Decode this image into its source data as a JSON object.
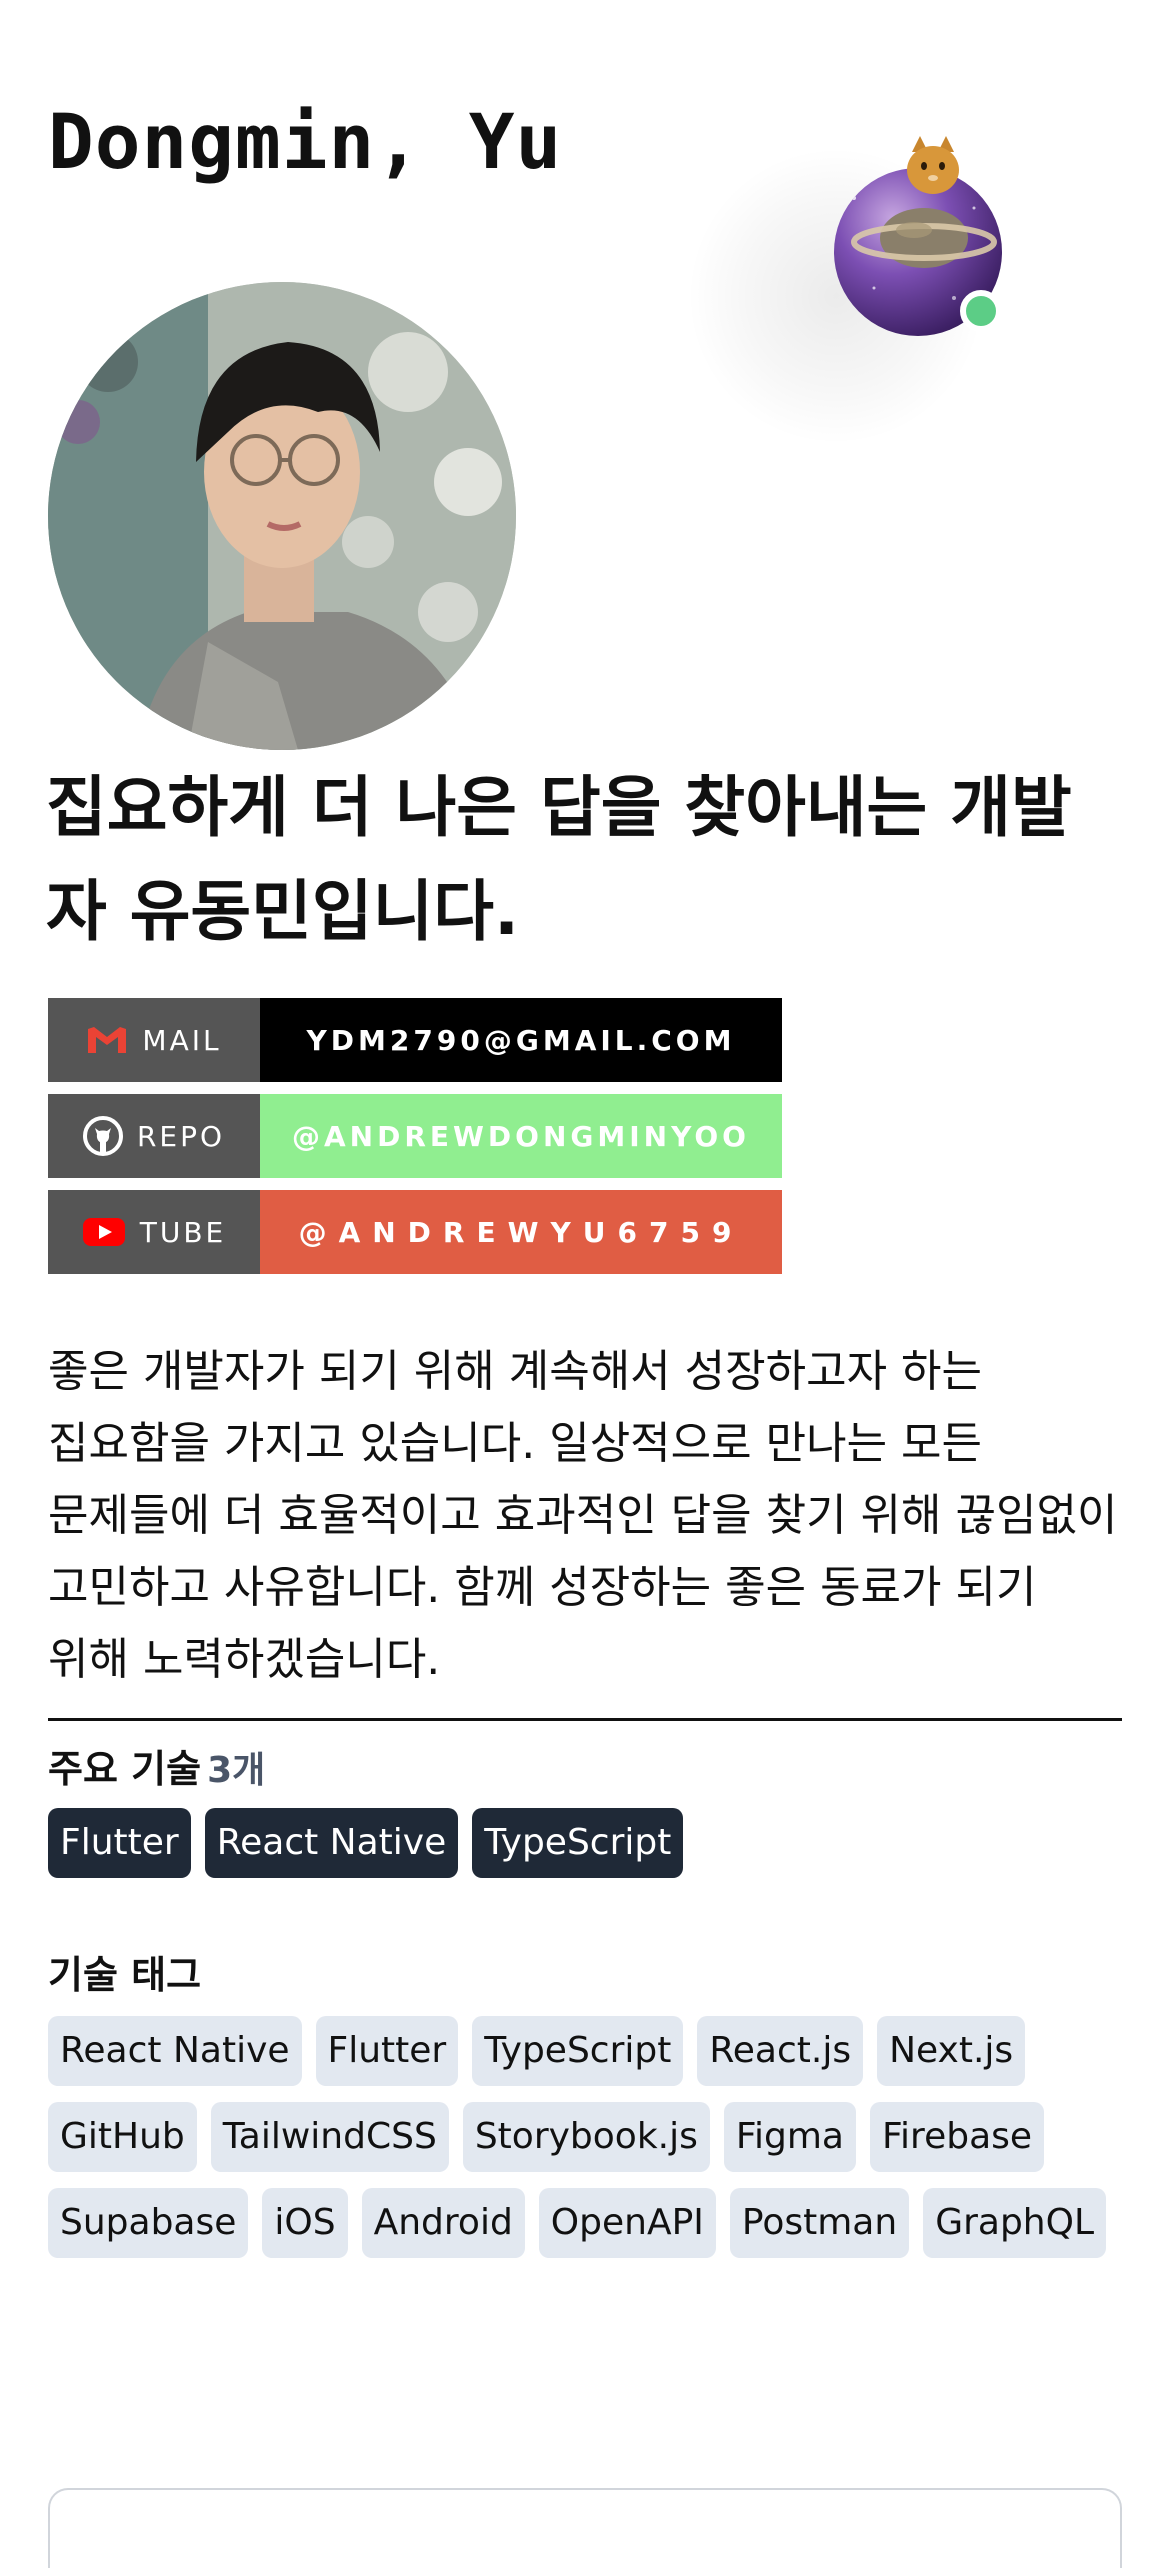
{
  "profile": {
    "name": "Dongmin, Yu",
    "headline": "집요하게 더 나은 답을 찾아내는 개발자 유동민입니다.",
    "intro": "좋은 개발자가 되기 위해 계속해서 성장하고자 하는 집요함을 가지고 있습니다. 일상적으로 만나는 모든 문제들에 더 효율적이고 효과적인 답을 찾기 위해 끊임없이 고민하고 사유합니다. 함께 성장하는 좋은 동료가 되기 위해 노력하겠습니다."
  },
  "badges": [
    {
      "icon": "gmail-icon",
      "label": "MAIL",
      "value": "YDM2790@GMAIL.COM",
      "color": "#000000"
    },
    {
      "icon": "github-icon",
      "label": "REPO",
      "value": "@ANDREWDONGMINYOO",
      "color": "#90ee90"
    },
    {
      "icon": "youtube-icon",
      "label": "TUBE",
      "value": "@ANDREWYU6759",
      "color": "#e05d44"
    }
  ],
  "main_skills": {
    "title": "주요 기술",
    "count": "3개",
    "items": [
      "Flutter",
      "React Native",
      "TypeScript"
    ]
  },
  "skill_tags": {
    "title": "기술 태그",
    "items": [
      "React Native",
      "Flutter",
      "TypeScript",
      "React.js",
      "Next.js",
      "GitHub",
      "TailwindCSS",
      "Storybook.js",
      "Figma",
      "Firebase",
      "Supabase",
      "iOS",
      "Android",
      "OpenAPI",
      "Postman",
      "GraphQL"
    ]
  },
  "colors": {
    "online": "#5ccd86",
    "chip_dark": "#1f2937",
    "chip_light": "#e2e8f0"
  }
}
